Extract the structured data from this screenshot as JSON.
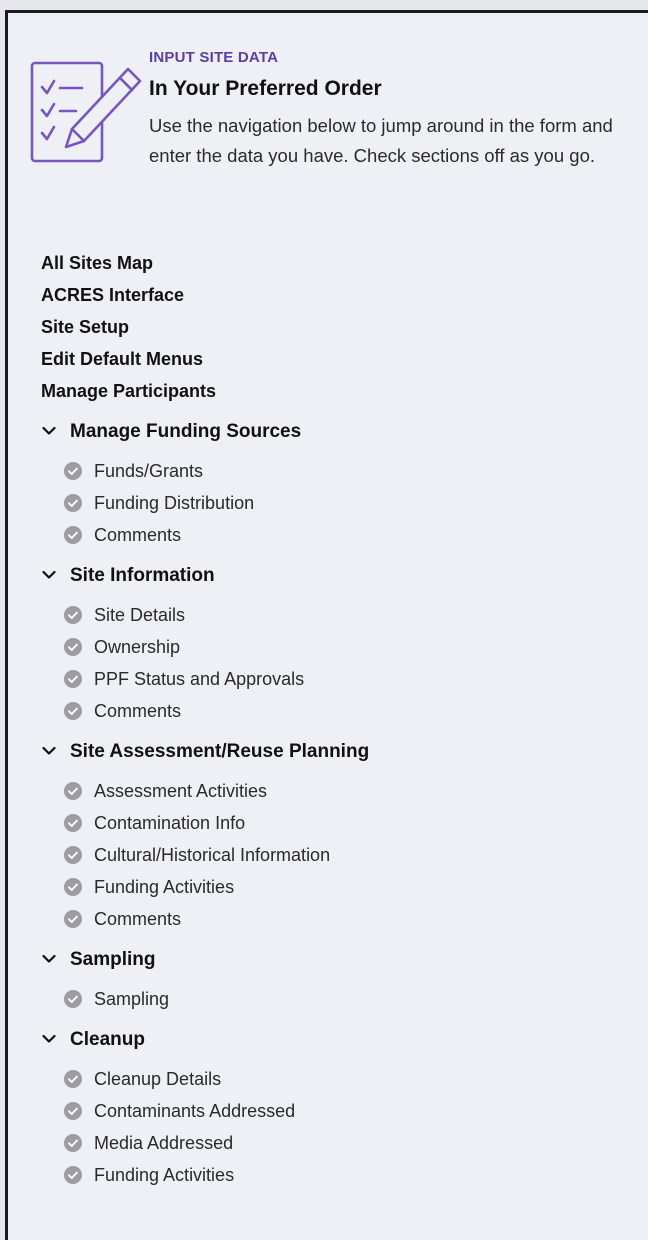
{
  "intro": {
    "eyebrow": "INPUT SITE DATA",
    "title": "In Your Preferred Order",
    "description": "Use the navigation below to jump around in the form and enter the data you have. Check sections off as you go.",
    "icon": "checklist-pencil-icon",
    "accent_color": "#5b3da6"
  },
  "links": [
    {
      "label": "All Sites Map"
    },
    {
      "label": "ACRES Interface"
    },
    {
      "label": "Site Setup"
    },
    {
      "label": "Edit Default Menus"
    },
    {
      "label": "Manage Participants"
    }
  ],
  "sections": [
    {
      "label": "Manage Funding Sources",
      "expanded": true,
      "items": [
        {
          "label": "Funds/Grants"
        },
        {
          "label": "Funding Distribution"
        },
        {
          "label": "Comments"
        }
      ]
    },
    {
      "label": "Site Information",
      "expanded": true,
      "items": [
        {
          "label": "Site Details"
        },
        {
          "label": "Ownership"
        },
        {
          "label": "PPF Status and Approvals"
        },
        {
          "label": "Comments"
        }
      ]
    },
    {
      "label": "Site Assessment/Reuse Planning",
      "expanded": true,
      "items": [
        {
          "label": "Assessment Activities"
        },
        {
          "label": "Contamination Info"
        },
        {
          "label": "Cultural/Historical Information"
        },
        {
          "label": "Funding Activities"
        },
        {
          "label": "Comments"
        }
      ]
    },
    {
      "label": "Sampling",
      "expanded": true,
      "items": [
        {
          "label": "Sampling"
        }
      ]
    },
    {
      "label": "Cleanup",
      "expanded": true,
      "items": [
        {
          "label": "Cleanup Details"
        },
        {
          "label": "Contaminants Addressed"
        },
        {
          "label": "Media Addressed"
        },
        {
          "label": "Funding Activities"
        }
      ]
    }
  ],
  "colors": {
    "check_circle": "#9c9ca2",
    "check_mark": "#ffffff",
    "panel_background": "#eef0f5",
    "border": "#1b1b1f"
  }
}
